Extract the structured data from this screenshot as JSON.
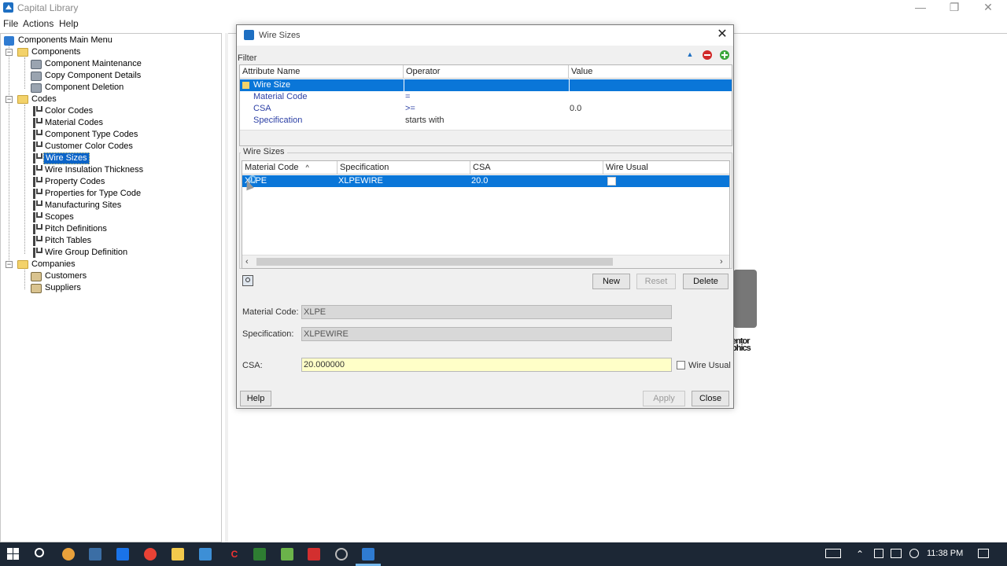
{
  "window": {
    "title": "Capital Library",
    "controls": {
      "minimize": "—",
      "maximize": "❐",
      "close": "✕"
    }
  },
  "menubar": [
    "File",
    "Actions",
    "Help"
  ],
  "tree": {
    "root": "Components Main Menu",
    "components": {
      "label": "Components",
      "items": [
        "Component Maintenance",
        "Copy Component Details",
        "Component Deletion"
      ]
    },
    "codes": {
      "label": "Codes",
      "items": [
        "Color Codes",
        "Material Codes",
        "Component Type Codes",
        "Customer Color Codes",
        "Wire Sizes",
        "Wire Insulation Thickness",
        "Property Codes",
        "Properties for Type Code",
        "Manufacturing Sites",
        "Scopes",
        "Pitch Definitions",
        "Pitch Tables",
        "Wire Group Definition"
      ],
      "selected": "Wire Sizes"
    },
    "companies": {
      "label": "Companies",
      "items": [
        "Customers",
        "Suppliers"
      ]
    }
  },
  "background_logo_text": "entor\nphics",
  "dialog": {
    "title": "Wire Sizes",
    "close": "✕",
    "filter": {
      "label": "Filter",
      "columns": [
        "Attribute Name",
        "Operator",
        "Value"
      ],
      "rows": [
        {
          "attr": "Wire Size",
          "op": "",
          "value": "",
          "selected": true
        },
        {
          "attr": "Material Code",
          "op": "=",
          "value": ""
        },
        {
          "attr": "CSA",
          "op": ">=",
          "value": "0.0"
        },
        {
          "attr": "Specification",
          "op": "starts with",
          "value": ""
        }
      ]
    },
    "wire_sizes": {
      "group_title": "Wire Sizes",
      "columns": [
        "Material Code",
        "Specification",
        "CSA",
        "Wire Usual"
      ],
      "sort_indicator": "^",
      "rows": [
        {
          "material_code": "XLPE",
          "specification": "XLPEWIRE",
          "csa": "20.0",
          "wire_usual": false
        }
      ]
    },
    "buttons": {
      "new": "New",
      "reset": "Reset",
      "delete": "Delete",
      "help": "Help",
      "apply": "Apply",
      "close": "Close"
    },
    "form": {
      "material_code_label": "Material Code:",
      "material_code_value": "XLPE",
      "specification_label": "Specification:",
      "specification_value": "XLPEWIRE",
      "csa_label": "CSA:",
      "csa_value": "20.000000",
      "wire_usual_label": "Wire Usual"
    }
  },
  "taskbar": {
    "clock": "11:38 PM",
    "colors": {
      "bg": "#1c2735",
      "active": "#76b9ed"
    }
  }
}
